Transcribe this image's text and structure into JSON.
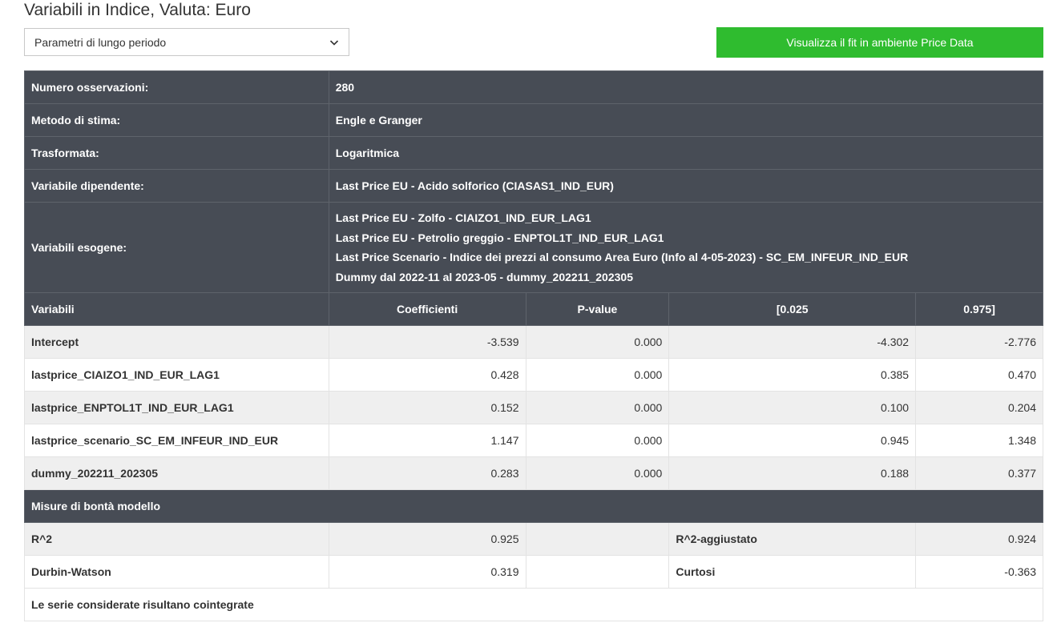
{
  "page": {
    "title": "Variabili in Indice, Valuta: Euro"
  },
  "controls": {
    "period_select": {
      "value": "Parametri di lungo periodo",
      "icon": "chevron-down-icon"
    },
    "fit_button": {
      "label": "Visualizza il fit in ambiente Price Data",
      "color": "#2fbc2f"
    }
  },
  "info": {
    "observations": {
      "label": "Numero osservazioni:",
      "value": "280"
    },
    "method": {
      "label": "Metodo di stima:",
      "value": "Engle e Granger"
    },
    "transform": {
      "label": "Trasformata:",
      "value": "Logaritmica"
    },
    "dependent": {
      "label": "Variabile dipendente:",
      "value": "Last Price EU - Acido solforico (CIASAS1_IND_EUR)"
    },
    "exogenous": {
      "label": "Variabili esogene:",
      "values": [
        "Last Price EU - Zolfo - CIAIZO1_IND_EUR_LAG1",
        "Last Price EU - Petrolio greggio - ENPTOL1T_IND_EUR_LAG1",
        "Last Price Scenario - Indice dei prezzi al consumo Area Euro (Info al 4-05-2023) - SC_EM_INFEUR_IND_EUR",
        "Dummy dal 2022-11 al 2023-05 - dummy_202211_202305"
      ]
    }
  },
  "coefficients": {
    "headers": [
      "Variabili",
      "Coefficienti",
      "P-value",
      "[0.025",
      "0.975]"
    ],
    "rows": [
      {
        "variable": "Intercept",
        "coef": "-3.539",
        "pvalue": "0.000",
        "low": "-4.302",
        "high": "-2.776"
      },
      {
        "variable": "lastprice_CIAIZO1_IND_EUR_LAG1",
        "coef": "0.428",
        "pvalue": "0.000",
        "low": "0.385",
        "high": "0.470"
      },
      {
        "variable": "lastprice_ENPTOL1T_IND_EUR_LAG1",
        "coef": "0.152",
        "pvalue": "0.000",
        "low": "0.100",
        "high": "0.204"
      },
      {
        "variable": "lastprice_scenario_SC_EM_INFEUR_IND_EUR",
        "coef": "1.147",
        "pvalue": "0.000",
        "low": "0.945",
        "high": "1.348"
      },
      {
        "variable": "dummy_202211_202305",
        "coef": "0.283",
        "pvalue": "0.000",
        "low": "0.188",
        "high": "0.377"
      }
    ]
  },
  "goodness": {
    "header": "Misure di bontà modello",
    "rows": [
      {
        "label1": "R^2",
        "value1": "0.925",
        "label2": "R^2-aggiustato",
        "value2": "0.924"
      },
      {
        "label1": "Durbin-Watson",
        "value1": "0.319",
        "label2": "Curtosi",
        "value2": "-0.363"
      }
    ],
    "conclusion": "Le serie considerate risultano cointegrate"
  }
}
